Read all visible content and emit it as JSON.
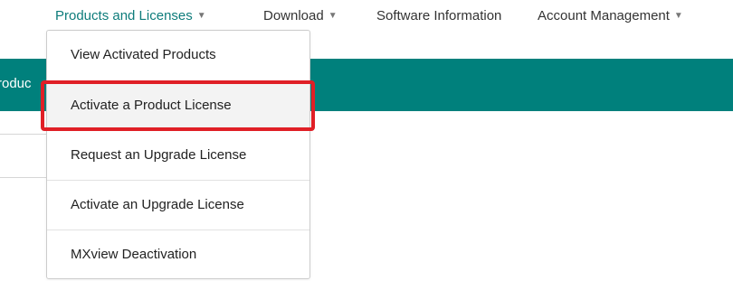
{
  "nav": {
    "products_label": "Products and Licenses",
    "download_label": "Download",
    "software_label": "Software Information",
    "account_label": "Account Management",
    "caret_icon": "chevron-down-icon"
  },
  "banner": {
    "partial_text": "Produc",
    "color": "#00807c"
  },
  "dropdown": {
    "items": [
      {
        "label": "View Activated Products"
      },
      {
        "label": "Activate a Product License"
      },
      {
        "label": "Request an Upgrade License"
      },
      {
        "label": "Activate an Upgrade License"
      },
      {
        "label": "MXview Deactivation"
      }
    ]
  },
  "colors": {
    "accent": "#0e7c7b",
    "highlight_border": "#e01f26"
  }
}
